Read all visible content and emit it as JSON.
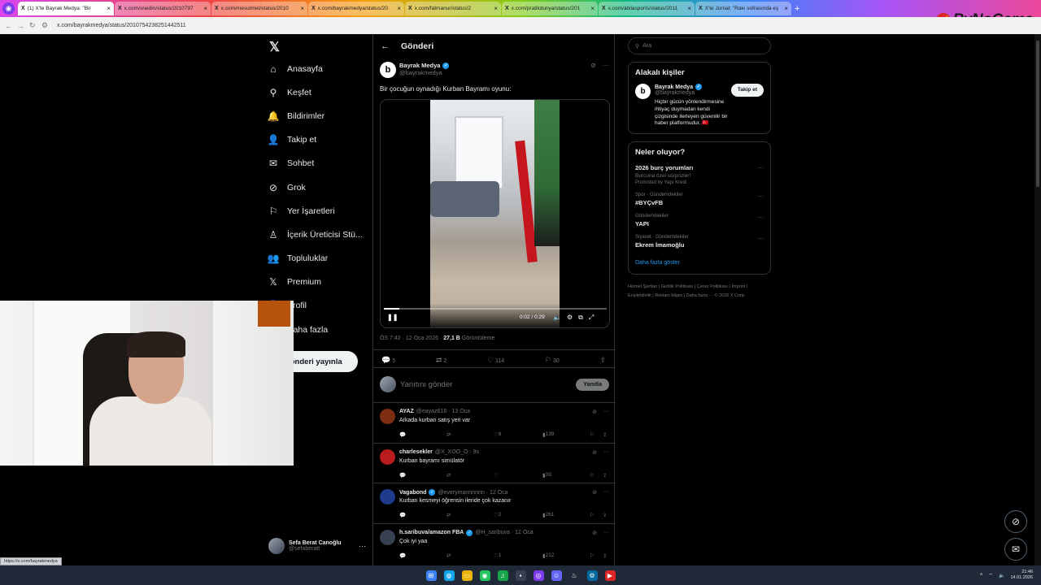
{
  "browser": {
    "tabs": [
      {
        "favicon": "X",
        "title": "(1) X'te Bayrak Medya: \"Bir",
        "active": true
      },
      {
        "favicon": "X",
        "title": "x.com/onedin/status/2010797",
        "active": false
      },
      {
        "favicon": "X",
        "title": "x.com/mesutmet/status/2010",
        "active": false
      },
      {
        "favicon": "X",
        "title": "x.com/bayrakmedya/status/20",
        "active": false
      },
      {
        "favicon": "X",
        "title": "x.com/fatmanur/status/2",
        "active": false
      },
      {
        "favicon": "X",
        "title": "x.com/pratikdunya/status/201",
        "active": false
      },
      {
        "favicon": "X",
        "title": "x.com/abilasports/status/2011",
        "active": false
      },
      {
        "favicon": "X",
        "title": "X'te Jurnal: \"Rakı sofrasında eş",
        "active": false
      }
    ],
    "new_tab": "+",
    "url": "x.com/bayrakmedya/status/2010754238251442511",
    "brand_overlay": "ByNoGame",
    "status_link": "https://x.com/bayrakmedya"
  },
  "leftnav": {
    "logo": "𝕏",
    "items": [
      {
        "icon": "home-icon",
        "glyph": "⌂",
        "label": "Anasayfa"
      },
      {
        "icon": "search-icon",
        "glyph": "⚲",
        "label": "Keşfet"
      },
      {
        "icon": "bell-icon",
        "glyph": "🔔",
        "label": "Bildirimler"
      },
      {
        "icon": "follow-icon",
        "glyph": "👤",
        "label": "Takip et"
      },
      {
        "icon": "mail-icon",
        "glyph": "✉",
        "label": "Sohbet"
      },
      {
        "icon": "grok-icon",
        "glyph": "⊘",
        "label": "Grok"
      },
      {
        "icon": "bookmark-icon",
        "glyph": "⚐",
        "label": "Yer İşaretleri"
      },
      {
        "icon": "creator-icon",
        "glyph": "♙",
        "label": "İçerik Üreticisi Stü..."
      },
      {
        "icon": "communities-icon",
        "glyph": "👥",
        "label": "Topluluklar"
      },
      {
        "icon": "premium-icon",
        "glyph": "𝕏",
        "label": "Premium"
      },
      {
        "icon": "profile-icon",
        "glyph": "👤",
        "label": "Profil"
      },
      {
        "icon": "more-icon",
        "glyph": "⋯",
        "label": "Daha fazla"
      }
    ],
    "post_button": "Gönderi yayınla",
    "account": {
      "name": "Sefa Berat Canoğlu",
      "handle": "@sefaberatt",
      "more": "···"
    }
  },
  "main": {
    "header_title": "Gönderi",
    "tweet": {
      "author_name": "Bayrak Medya",
      "author_handle": "@bayrakmedya",
      "avatar_letter": "b",
      "text": "Bir çocuğun oynadığı Kurban Bayramı oyunu:",
      "video": {
        "time": "0:02 / 0:29",
        "progress": 0.07
      },
      "time_label": "ÖS 7:42 · 12 Oca 2026 · ",
      "views": "27,1 B",
      "views_label": " Görüntüleme",
      "stats": {
        "replies": "5",
        "reposts": "2",
        "likes": "114",
        "bookmarks": "30"
      }
    },
    "reply_box": {
      "placeholder": "Yanıtını gönder",
      "button": "Yanıtla"
    },
    "comments": [
      {
        "name": "AYAZ",
        "handle": "@eayaz616 · 13 Oca",
        "verified": false,
        "text": "Arkada kurban satış yeri var",
        "likes": "6",
        "views": "139"
      },
      {
        "name": "charlesekler",
        "handle": "@X_XOO_O · 9s",
        "verified": false,
        "text": "Kurban bayramı simülatör",
        "likes": "",
        "views": "39"
      },
      {
        "name": "Vagabond",
        "handle": "@everymannnnnn · 12 Oca",
        "verified": true,
        "text": "Kurban kesmeyi öğrensin ileride çok kazanır",
        "likes": "2",
        "views": "261"
      },
      {
        "name": "h.saribuva/amazon FBA",
        "handle": "@H_saribuva · 12 Oca",
        "verified": true,
        "text": "Çok iyi yaa",
        "likes": "1",
        "views": "212"
      }
    ]
  },
  "right": {
    "search_placeholder": "Ara",
    "related": {
      "title": "Alakalı kişiler",
      "name": "Bayrak Medya",
      "handle": "@bayrakmedya",
      "bio": "Hiçbir gücün yönlendirmesine ihtiyaç duymadan kendi çizgisinde ilerleyen güvenilir bir haber platformudur. 🇹🇷",
      "follow": "Takip et"
    },
    "trends": {
      "title": "Neler oluyor?",
      "items": [
        {
          "category": "",
          "title": "2026 burç yorumları",
          "sub": "Burcuna özel sürprizler!",
          "promo": "Promoted by Yapı Kredi"
        },
        {
          "category": "Spor · Gündemdekiler",
          "title": "#BYÇvFB",
          "sub": "",
          "promo": ""
        },
        {
          "category": "Gündemdekiler",
          "title": "YAPI",
          "sub": "",
          "promo": ""
        },
        {
          "category": "Siyaset · Gündemdekiler",
          "title": "Ekrem İmamoğlu",
          "sub": "",
          "promo": ""
        }
      ],
      "show_more": "Daha fazla göster"
    },
    "footer": "Hizmet Şartları | Gizlilik Politikası | Çerez Politikası | İmprint | Erişilebilirlik | Reklam bilgisi | Daha fazla ··· © 2026 X Corp."
  },
  "taskbar": {
    "clock_time": "21:46",
    "clock_date": "14.01.2026"
  }
}
